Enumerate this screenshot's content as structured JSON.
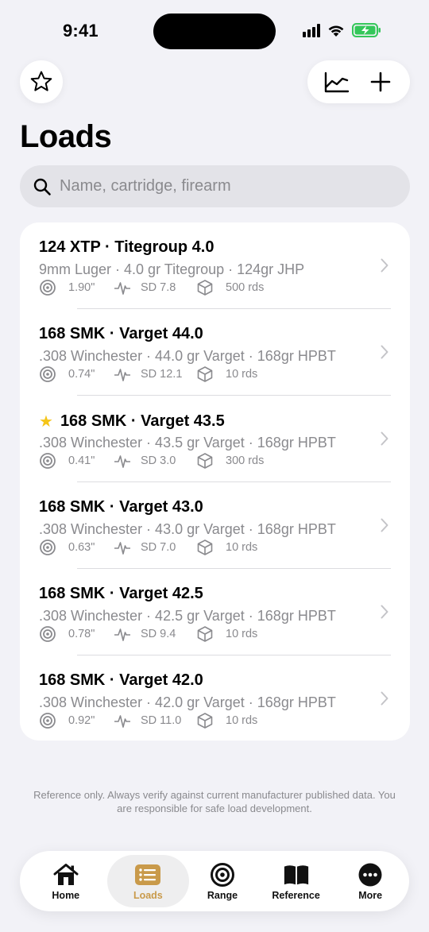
{
  "status": {
    "time": "9:41"
  },
  "header": {
    "title": "Loads",
    "search_placeholder": "Name, cartridge, firearm"
  },
  "loads": [
    {
      "title": "124 XTP · Titegroup 4.0",
      "favorite": false,
      "subtitle": "9mm Luger · 4.0 gr Titegroup · 124gr JHP",
      "group": "1.90\"",
      "sd": "SD 7.8",
      "rounds": "500 rds"
    },
    {
      "title": "168 SMK · Varget 44.0",
      "favorite": false,
      "subtitle": ".308 Winchester · 44.0 gr Varget · 168gr HPBT",
      "group": "0.74\"",
      "sd": "SD 12.1",
      "rounds": "10 rds"
    },
    {
      "title": "168 SMK · Varget 43.5",
      "favorite": true,
      "subtitle": ".308 Winchester · 43.5 gr Varget · 168gr HPBT",
      "group": "0.41\"",
      "sd": "SD 3.0",
      "rounds": "300 rds"
    },
    {
      "title": "168 SMK · Varget 43.0",
      "favorite": false,
      "subtitle": ".308 Winchester · 43.0 gr Varget · 168gr HPBT",
      "group": "0.63\"",
      "sd": "SD 7.0",
      "rounds": "10 rds"
    },
    {
      "title": "168 SMK · Varget 42.5",
      "favorite": false,
      "subtitle": ".308 Winchester · 42.5 gr Varget · 168gr HPBT",
      "group": "0.78\"",
      "sd": "SD 9.4",
      "rounds": "10 rds"
    },
    {
      "title": "168 SMK · Varget 42.0",
      "favorite": false,
      "subtitle": ".308 Winchester · 42.0 gr Varget · 168gr HPBT",
      "group": "0.92\"",
      "sd": "SD 11.0",
      "rounds": "10 rds"
    }
  ],
  "disclaimer": "Reference only. Always verify against current manufacturer published data. You are responsible for safe load development.",
  "tabs": [
    {
      "label": "Home",
      "icon": "home-icon",
      "active": false
    },
    {
      "label": "Loads",
      "icon": "list-icon",
      "active": true
    },
    {
      "label": "Range",
      "icon": "target-icon",
      "active": false
    },
    {
      "label": "Reference",
      "icon": "book-icon",
      "active": false
    },
    {
      "label": "More",
      "icon": "more-icon",
      "active": false
    }
  ],
  "colors": {
    "accent": "#c99a4a",
    "favorite": "#f5c518",
    "battery": "#34c759"
  }
}
